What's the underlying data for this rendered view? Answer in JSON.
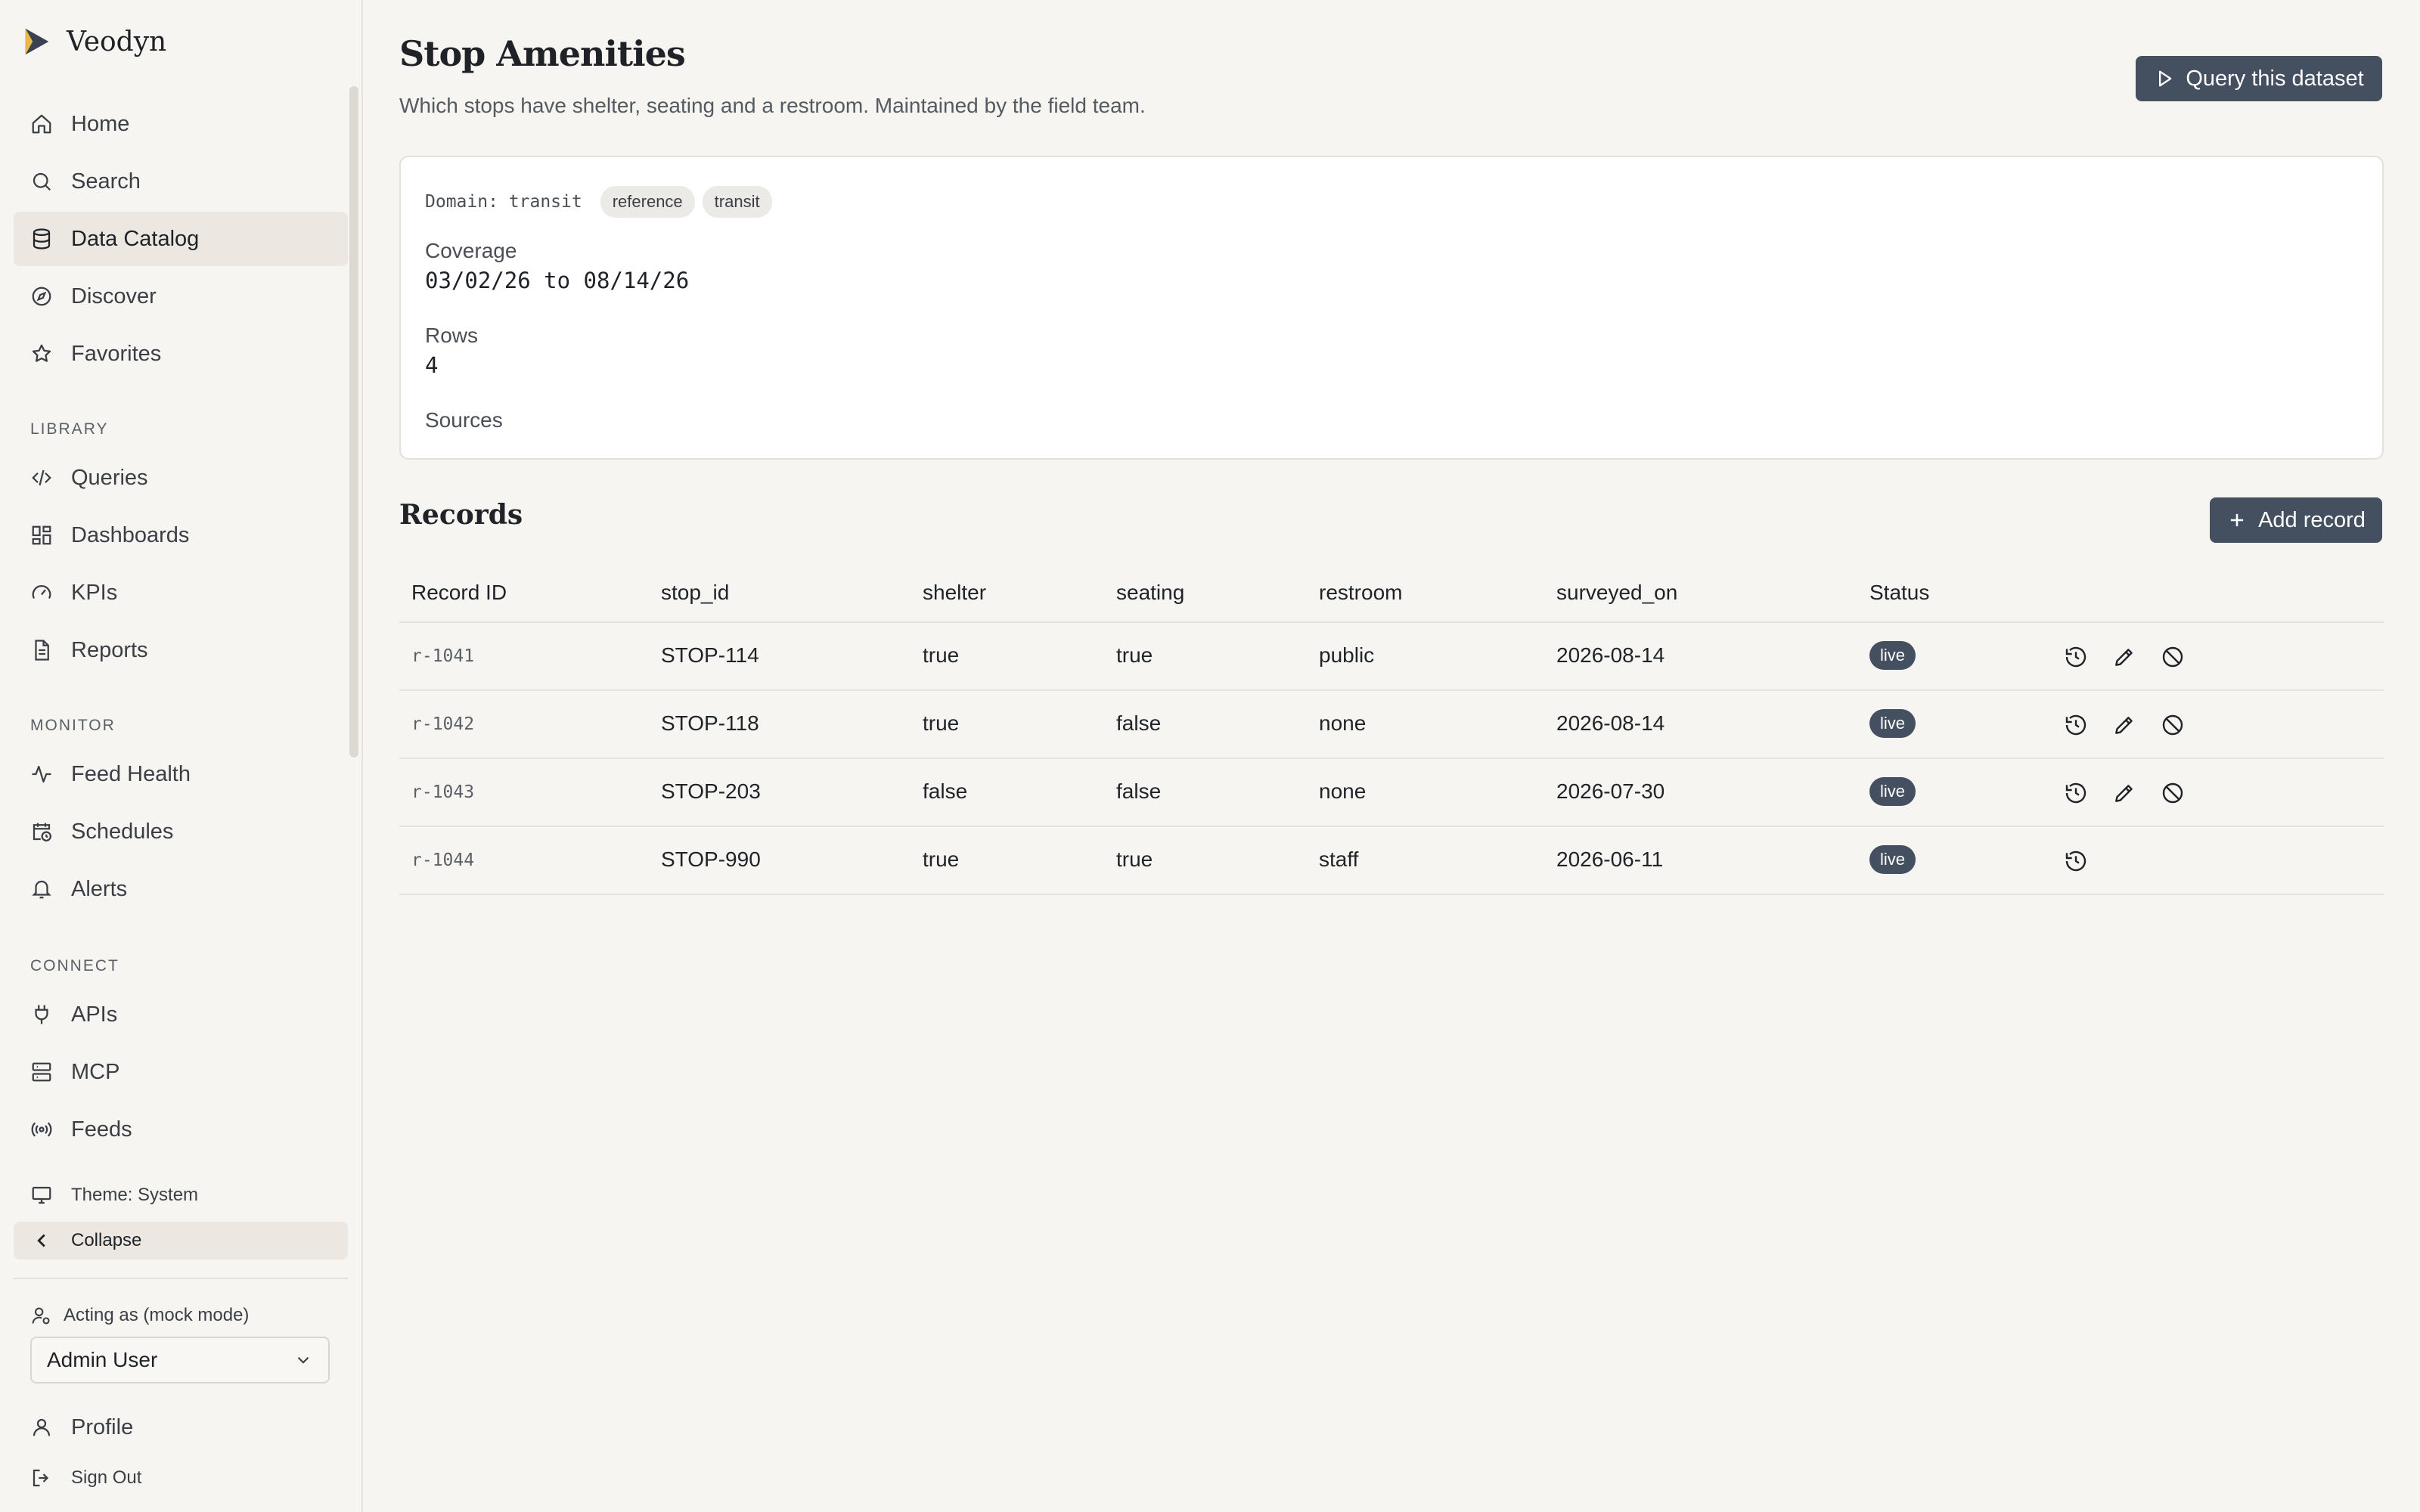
{
  "app": {
    "name": "Veodyn"
  },
  "nav": {
    "primary": [
      {
        "label": "Home",
        "icon": "home-icon"
      },
      {
        "label": "Search",
        "icon": "search-icon"
      },
      {
        "label": "Data Catalog",
        "icon": "database-icon",
        "active": true
      },
      {
        "label": "Discover",
        "icon": "compass-icon"
      },
      {
        "label": "Favorites",
        "icon": "star-icon"
      }
    ],
    "library_label": "LIBRARY",
    "library": [
      {
        "label": "Queries",
        "icon": "code-icon"
      },
      {
        "label": "Dashboards",
        "icon": "dashboard-icon"
      },
      {
        "label": "KPIs",
        "icon": "gauge-icon"
      },
      {
        "label": "Reports",
        "icon": "document-icon"
      }
    ],
    "monitor_label": "MONITOR",
    "monitor": [
      {
        "label": "Feed Health",
        "icon": "activity-icon"
      },
      {
        "label": "Schedules",
        "icon": "calendar-clock-icon"
      },
      {
        "label": "Alerts",
        "icon": "bell-icon"
      }
    ],
    "connect_label": "CONNECT",
    "connect": [
      {
        "label": "APIs",
        "icon": "plug-icon"
      },
      {
        "label": "MCP",
        "icon": "server-icon"
      },
      {
        "label": "Feeds",
        "icon": "broadcast-icon"
      }
    ],
    "theme_label": "Theme: System",
    "collapse_label": "Collapse",
    "acting_label": "Acting as (mock mode)",
    "acting_user": "Admin User",
    "profile_label": "Profile",
    "signout_label": "Sign Out"
  },
  "page": {
    "title": "Stop Amenities",
    "subtitle": "Which stops have shelter, seating and a restroom. Maintained by the field team.",
    "query_button": "Query this dataset"
  },
  "meta": {
    "domain": "Domain: transit",
    "tags": [
      "reference",
      "transit"
    ],
    "coverage_label": "Coverage",
    "coverage_value": "03/02/26 to 08/14/26",
    "rows_label": "Rows",
    "rows_value": "4",
    "sources_label": "Sources"
  },
  "records": {
    "title": "Records",
    "add_button": "Add record",
    "columns": [
      "Record ID",
      "stop_id",
      "shelter",
      "seating",
      "restroom",
      "surveyed_on",
      "Status"
    ],
    "rows": [
      {
        "id": "r-1041",
        "stop_id": "STOP-114",
        "shelter": "true",
        "seating": "true",
        "restroom": "public",
        "surveyed_on": "2026-08-14",
        "status": "live",
        "editable": true
      },
      {
        "id": "r-1042",
        "stop_id": "STOP-118",
        "shelter": "true",
        "seating": "false",
        "restroom": "none",
        "surveyed_on": "2026-08-14",
        "status": "live",
        "editable": true
      },
      {
        "id": "r-1043",
        "stop_id": "STOP-203",
        "shelter": "false",
        "seating": "false",
        "restroom": "none",
        "surveyed_on": "2026-07-30",
        "status": "live",
        "editable": true
      },
      {
        "id": "r-1044",
        "stop_id": "STOP-990",
        "shelter": "true",
        "seating": "true",
        "restroom": "staff",
        "surveyed_on": "2026-06-11",
        "status": "live",
        "editable": false
      }
    ]
  },
  "colors": {
    "accent": "#444f60",
    "background": "#f6f5f1",
    "logo_yellow": "#e8b84a"
  }
}
